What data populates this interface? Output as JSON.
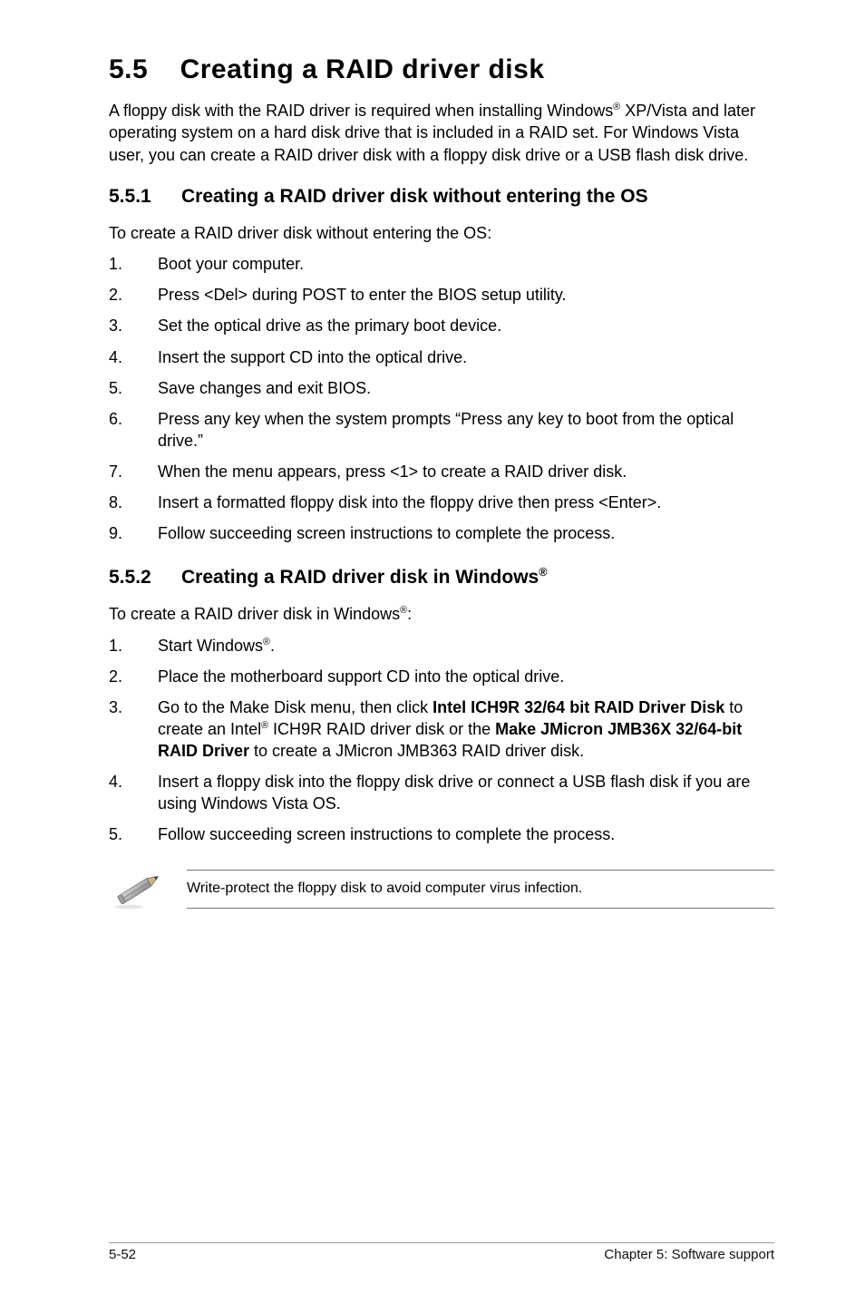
{
  "section": {
    "number": "5.5",
    "title": "Creating a RAID driver disk"
  },
  "intro_html": "A floppy disk with the RAID driver is required when installing Windows<sup>®</sup> XP/Vista and later operating system on a hard disk drive that is included in a RAID set. For Windows Vista user, you can create a RAID driver disk with a floppy disk drive or a USB flash disk drive.",
  "sub1": {
    "number": "5.5.1",
    "title": "Creating a RAID driver disk without entering the OS",
    "lead": "To create a RAID driver disk without entering the OS:",
    "steps": [
      "Boot your computer.",
      "Press <Del> during POST to enter the BIOS setup utility.",
      "Set the optical drive as the primary boot device.",
      "Insert the support CD into the optical drive.",
      "Save changes and exit BIOS.",
      "Press any key when the system prompts “Press any key to boot from the optical drive.”",
      "When the menu appears, press <1> to create a RAID driver disk.",
      "Insert a formatted floppy disk into the floppy drive then press <Enter>.",
      "Follow succeeding screen instructions to complete the process."
    ]
  },
  "sub2": {
    "number": "5.5.2",
    "title_html": "Creating a RAID driver disk in Windows<sup>®</sup>",
    "lead_html": "To create a RAID driver disk in Windows<sup>®</sup>:",
    "steps_html": [
      "Start Windows<sup>®</sup>.",
      "Place the motherboard support CD into the optical drive.",
      "Go to the Make Disk menu, then click <b>Intel ICH9R 32/64 bit RAID Driver Disk</b> to create an Intel<sup>®</sup> ICH9R RAID driver disk or the <b>Make JMicron JMB36X 32/64-bit RAID Driver</b> to create a JMicron JMB363 RAID driver disk.",
      "Insert a floppy disk into the floppy disk drive or connect a USB flash disk if you are using Windows Vista OS.",
      "Follow succeeding screen instructions to complete the process."
    ]
  },
  "note": "Write-protect the floppy disk to avoid computer virus infection.",
  "footer": {
    "left": "5-52",
    "right": "Chapter 5: Software support"
  }
}
